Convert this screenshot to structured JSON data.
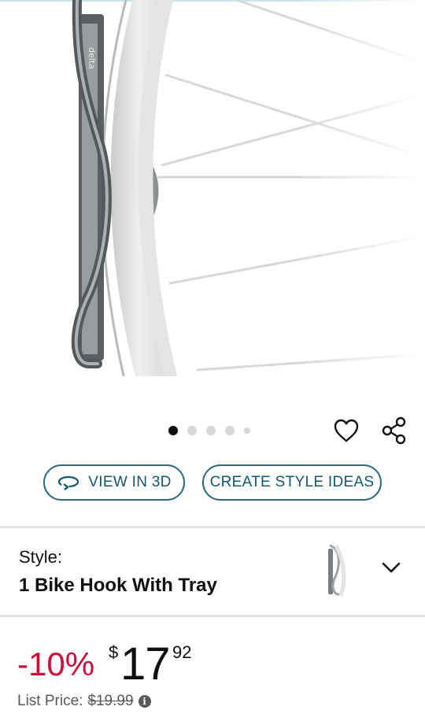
{
  "product_image": {
    "icon": "bike-hook-wall-mount-with-wheel"
  },
  "carousel": {
    "dot_count": 5,
    "active_index": 0
  },
  "actions": {
    "wishlist_icon": "heart-icon",
    "share_icon": "share-icon"
  },
  "buttons": {
    "view_3d": "VIEW IN 3D",
    "style_ideas": "CREATE STYLE IDEAS"
  },
  "style": {
    "label": "Style:",
    "value": "1 Bike Hook With Tray"
  },
  "price": {
    "discount": "-10%",
    "currency": "$",
    "whole": "17",
    "fraction": "92",
    "list_label": "List Price:",
    "list_value": "$19.99"
  },
  "colors": {
    "accent": "#13566d",
    "discount": "#cc0c39",
    "muted": "#565959",
    "divider": "#e3e6e6"
  }
}
